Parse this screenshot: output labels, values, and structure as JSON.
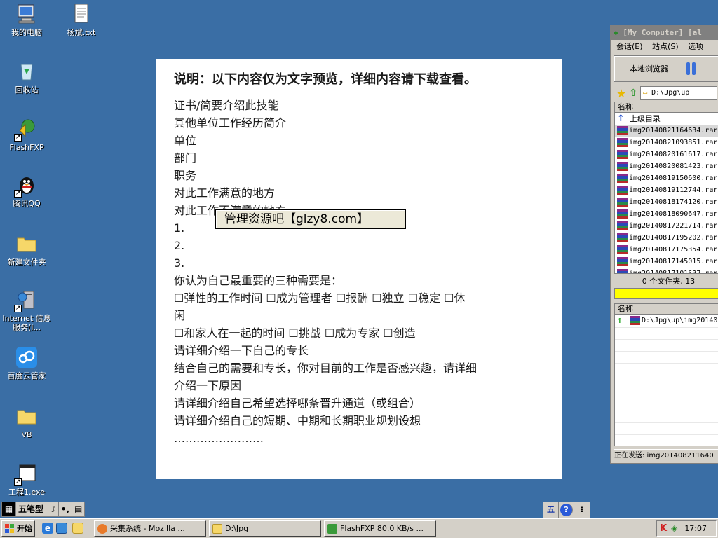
{
  "desktop": {
    "icons": [
      {
        "label": "我的电脑",
        "icon": "computer-icon"
      },
      {
        "label": "杨斌.txt",
        "icon": "text-file-icon"
      },
      {
        "label": "回收站",
        "icon": "recycle-bin-icon"
      },
      {
        "label": "FlashFXP",
        "icon": "flashfxp-icon"
      },
      {
        "label": "腾讯QQ",
        "icon": "qq-penguin-icon"
      },
      {
        "label": "新建文件夹",
        "icon": "folder-icon"
      },
      {
        "label": "Internet 信息服务(I...",
        "icon": "iis-icon"
      },
      {
        "label": "百度云管家",
        "icon": "baidu-cloud-icon"
      },
      {
        "label": "VB",
        "icon": "folder-icon"
      },
      {
        "label": "工程1.exe",
        "icon": "exe-icon"
      }
    ]
  },
  "document": {
    "heading": "说明：以下内容仅为文字预览，详细内容请下载查看。",
    "lines": [
      "证书/简要介绍此技能",
      "其他单位工作经历简介",
      "单位",
      "部门",
      "职务",
      "对此工作满意的地方",
      "对此工作不满意的地方",
      "1.",
      "2.",
      "3.",
      "你认为自己最重要的三种需要是：",
      "☐弹性的工作时间 ☐成为管理者 ☐报酬 ☐独立 ☐稳定 ☐休",
      "闲",
      "☐和家人在一起的时间 ☐挑战 ☐成为专家 ☐创造",
      "请详细介绍一下自己的专长",
      "结合自己的需要和专长，你对目前的工作是否感兴趣，请详细",
      "介绍一下原因",
      "请详细介绍自己希望选择哪条晋升通道（或组合）",
      "请详细介绍自己的短期、中期和长期职业规划设想",
      "……………………"
    ],
    "watermark": "管理资源吧【glzy8.com】"
  },
  "flashfxp": {
    "title": "[My Computer]  [al",
    "menu": [
      "会话(E)",
      "站点(S)",
      "选项"
    ],
    "local_browser_label": "本地浏览器",
    "path": "D:\\Jpg\\up",
    "list_header": "名称",
    "parent_dir": "上级目录",
    "files": [
      "img20140821164634.rar",
      "img20140821093851.rar",
      "img20140820161617.rar",
      "img20140820081423.rar",
      "img20140819150600.rar",
      "img20140819112744.rar",
      "img20140818174120.rar",
      "img20140818090647.rar",
      "img20140817221714.rar",
      "img20140817195202.rar",
      "img20140817175354.rar",
      "img20140817145015.rar",
      "img20140817101637.rar"
    ],
    "status": "0 个文件夹, 13",
    "queue_header": "名称",
    "queue_item": "D:\\Jpg\\up\\img20140",
    "sending": "正在发送: img201408211640"
  },
  "ime": {
    "mode": "五笔型",
    "buttons": [
      "moon-icon",
      "punct-icon",
      "keyboard-icon"
    ]
  },
  "tray_mini": [
    "五",
    "?",
    "⁝"
  ],
  "taskbar": {
    "start_label": "开始",
    "tasks": [
      {
        "label": "采集系统 - Mozilla ...",
        "icon": "firefox-icon"
      },
      {
        "label": "D:\\Jpg",
        "icon": "folder-icon"
      },
      {
        "label": "FlashFXP 80.0 KB/s ...",
        "icon": "flashfxp-icon"
      }
    ],
    "clock": "17:07"
  }
}
